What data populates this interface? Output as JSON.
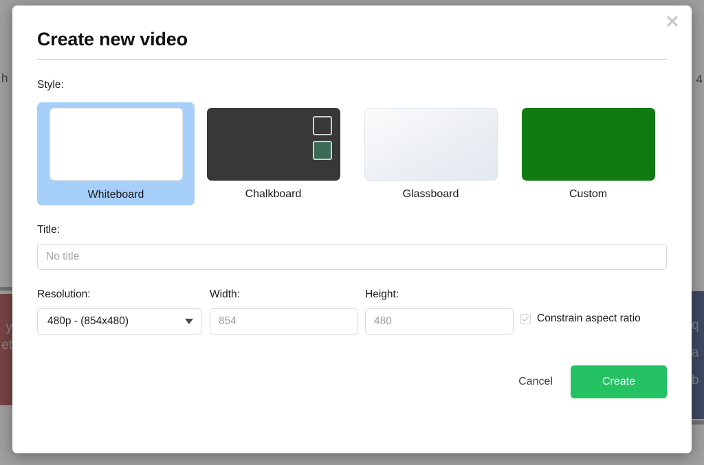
{
  "background": {
    "left_text": "h",
    "right_text": "4",
    "left_card_text": "y\net",
    "right_card_text": "q\np\na\nb"
  },
  "modal": {
    "title": "Create new video",
    "close_icon": "close-icon",
    "style": {
      "label": "Style:",
      "options": [
        {
          "label": "Whiteboard",
          "selected": true
        },
        {
          "label": "Chalkboard",
          "selected": false
        },
        {
          "label": "Glassboard",
          "selected": false
        },
        {
          "label": "Custom",
          "selected": false
        }
      ],
      "selected_value": "Whiteboard",
      "selection_color": "#a6cff9",
      "custom_color": "#117a11",
      "chalkboard_color": "#383838",
      "chalkboard_swatch_color": "#3b6b56"
    },
    "title_field": {
      "label": "Title:",
      "value": "",
      "placeholder": "No title"
    },
    "resolution": {
      "label": "Resolution:",
      "selected": "480p  -  (854x480)",
      "caret_icon": "chevron-down-icon"
    },
    "width": {
      "label": "Width:",
      "value": "",
      "placeholder": "854"
    },
    "height": {
      "label": "Height:",
      "value": "",
      "placeholder": "480"
    },
    "constrain": {
      "label": "Constrain aspect ratio",
      "checked": true,
      "icon": "checkmark-icon"
    },
    "footer": {
      "cancel_label": "Cancel",
      "create_label": "Create",
      "create_color": "#24c263"
    }
  }
}
